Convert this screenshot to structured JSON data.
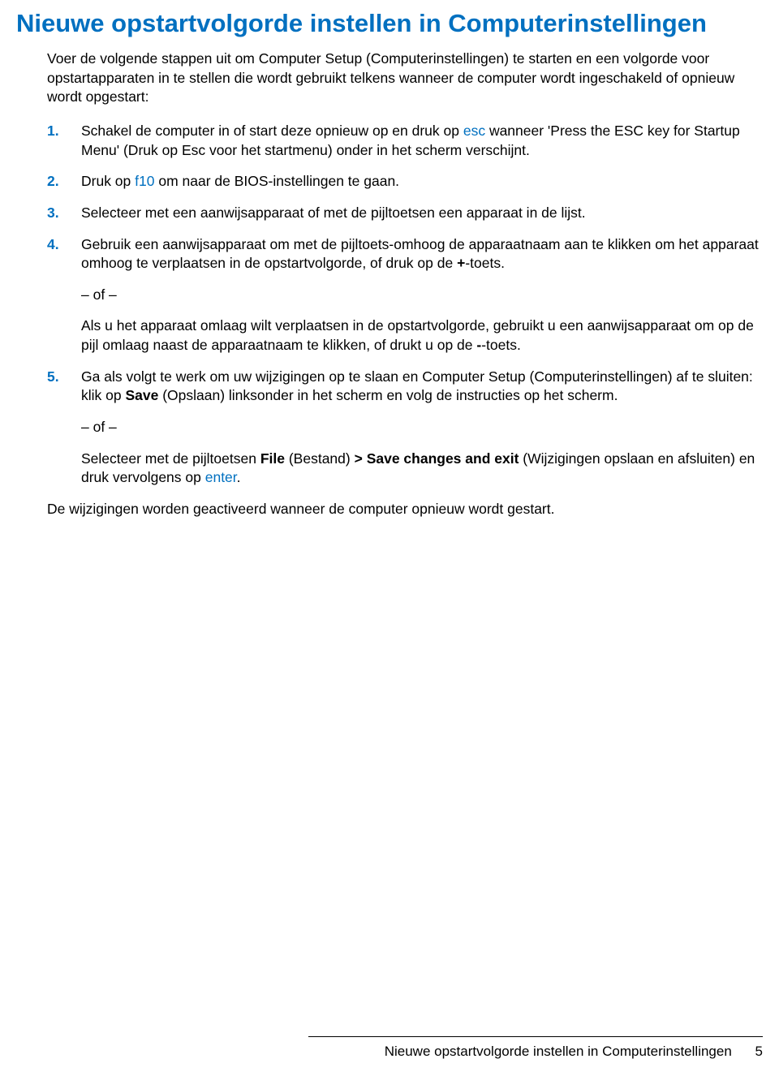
{
  "title": "Nieuwe opstartvolgorde instellen in Computerinstellingen",
  "intro": "Voer de volgende stappen uit om Computer Setup (Computerinstellingen) te starten en een volgorde voor opstartapparaten in te stellen die wordt gebruikt telkens wanneer de computer wordt ingeschakeld of opnieuw wordt opgestart:",
  "steps": {
    "s1": {
      "num": "1.",
      "t1": "Schakel de computer in of start deze opnieuw op en druk op ",
      "esc": "esc",
      "t2": " wanneer 'Press the ESC key for Startup Menu' (Druk op Esc voor het startmenu) onder in het scherm verschijnt."
    },
    "s2": {
      "num": "2.",
      "t1": "Druk op ",
      "f10": "f10",
      "t2": " om naar de BIOS-instellingen te gaan."
    },
    "s3": {
      "num": "3.",
      "t1": "Selecteer met een aanwijsapparaat of met de pijltoetsen een apparaat in de lijst."
    },
    "s4": {
      "num": "4.",
      "t1": "Gebruik een aanwijsapparaat om met de pijltoets-omhoog de apparaatnaam aan te klikken om het apparaat omhoog te verplaatsen in de opstartvolgorde, of druk op de ",
      "plus": "+",
      "t2": "-toets.",
      "of1": "– of –",
      "t3": "Als u het apparaat omlaag wilt verplaatsen in de opstartvolgorde, gebruikt u een aanwijsapparaat om op de pijl omlaag naast de apparaatnaam te klikken, of drukt u op de ",
      "minus": "-",
      "t4": "-toets."
    },
    "s5": {
      "num": "5.",
      "t1": "Ga als volgt te werk om uw wijzigingen op te slaan en Computer Setup (Computerinstellingen) af te sluiten: klik op ",
      "save": "Save",
      "t2": " (Opslaan) linksonder in het scherm en volg de instructies op het scherm.",
      "of1": "– of –",
      "t3": "Selecteer met de pijltoetsen ",
      "file": "File",
      "t4": " (Bestand) ",
      "gt": "> ",
      "sce": "Save changes and exit",
      "t5": " (Wijzigingen opslaan en afsluiten) en druk vervolgens op ",
      "enter": "enter",
      "t6": "."
    }
  },
  "closing": "De wijzigingen worden geactiveerd wanneer de computer opnieuw wordt gestart.",
  "footer": {
    "title": "Nieuwe opstartvolgorde instellen in Computerinstellingen",
    "page": "5"
  }
}
